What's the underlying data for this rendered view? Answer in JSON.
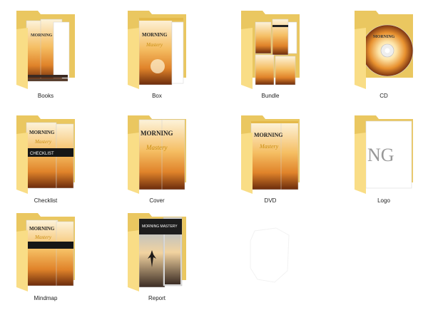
{
  "window": {
    "title": ""
  },
  "folders": [
    {
      "name": "Books",
      "kind": "book-stack"
    },
    {
      "name": "Box",
      "kind": "box"
    },
    {
      "name": "Bundle",
      "kind": "bundle"
    },
    {
      "name": "CD",
      "kind": "cd"
    },
    {
      "name": "Checklist",
      "kind": "checklist"
    },
    {
      "name": "Cover",
      "kind": "cover"
    },
    {
      "name": "DVD",
      "kind": "dvd"
    },
    {
      "name": "Logo",
      "kind": "logo"
    },
    {
      "name": "Mindmap",
      "kind": "mindmap"
    },
    {
      "name": "Report",
      "kind": "report"
    }
  ],
  "product": {
    "title_line1": "MORNING",
    "title_line2": "Mastery",
    "checklist_word": "CHECKLIST",
    "logo_letters": "NG",
    "report_title": "MORNING MASTERY"
  },
  "colors": {
    "folder_back": "#eac760",
    "folder_front": "#f9dd86",
    "folder_tab": "#e5bf55",
    "accent_gold": "#c98e12",
    "sunset_top": "#fde7b8",
    "sunset_mid": "#f2a84b",
    "sunset_dark": "#8a3d12"
  },
  "icons": {
    "folder": "folder-icon",
    "blank_file": "blank-file-icon"
  }
}
